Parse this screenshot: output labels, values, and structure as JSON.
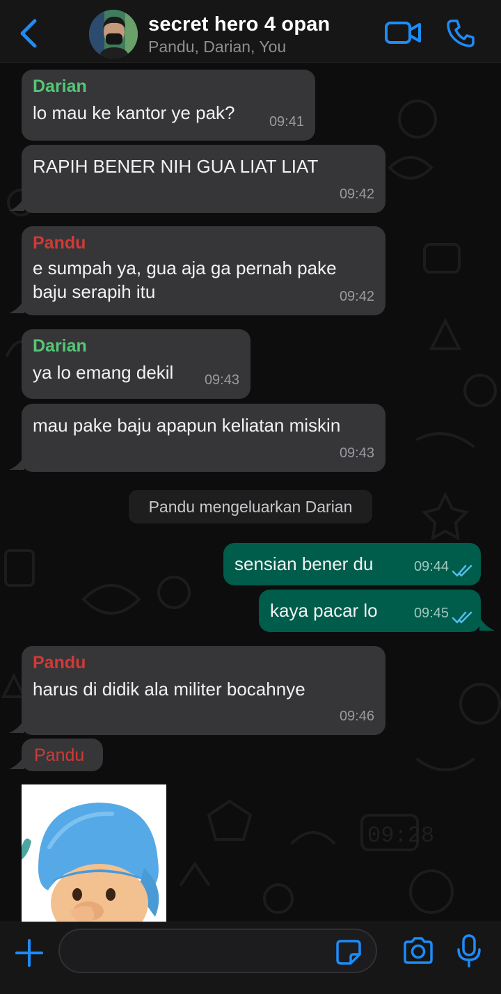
{
  "header": {
    "title": "secret hero 4 opan",
    "subtitle": "Pandu, Darian, You"
  },
  "messages": [
    {
      "sender": "Darian",
      "text": "lo mau ke kantor ye pak?",
      "time": "09:41",
      "direction": "in"
    },
    {
      "sender": "",
      "text": "RAPIH BENER NIH GUA LIAT LIAT",
      "time": "09:42",
      "direction": "in"
    },
    {
      "sender": "Pandu",
      "text": "e sumpah ya, gua aja ga pernah pake baju serapih itu",
      "time": "09:42",
      "direction": "in"
    },
    {
      "sender": "Darian",
      "text": "ya lo emang dekil",
      "time": "09:43",
      "direction": "in"
    },
    {
      "sender": "",
      "text": "mau pake baju apapun keliatan miskin",
      "time": "09:43",
      "direction": "in"
    },
    {
      "sender": "",
      "text": "sensian bener du",
      "time": "09:44",
      "direction": "out",
      "status": "read"
    },
    {
      "sender": "",
      "text": "kaya pacar lo",
      "time": "09:45",
      "direction": "out",
      "status": "read"
    },
    {
      "sender": "Pandu",
      "text": "harus di didik ala militer bocahnye",
      "time": "09:46",
      "direction": "in"
    },
    {
      "sender": "Pandu",
      "text": "",
      "time": "",
      "direction": "in",
      "type": "sticker"
    }
  ],
  "system": {
    "text": "Pandu mengeluarkan Darian"
  },
  "colors": {
    "accent": "#1d8cf8",
    "incoming_bubble": "#363638",
    "outgoing_bubble": "#005c4b",
    "darian": "#56c677",
    "pandu": "#d03a36",
    "read_ticks": "#53bdeb"
  },
  "icons": [
    "back-icon",
    "video-call-icon",
    "phone-icon",
    "plus-icon",
    "sticker-icon",
    "camera-icon",
    "mic-icon",
    "double-check-icon"
  ],
  "input": {
    "value": "",
    "placeholder": ""
  }
}
